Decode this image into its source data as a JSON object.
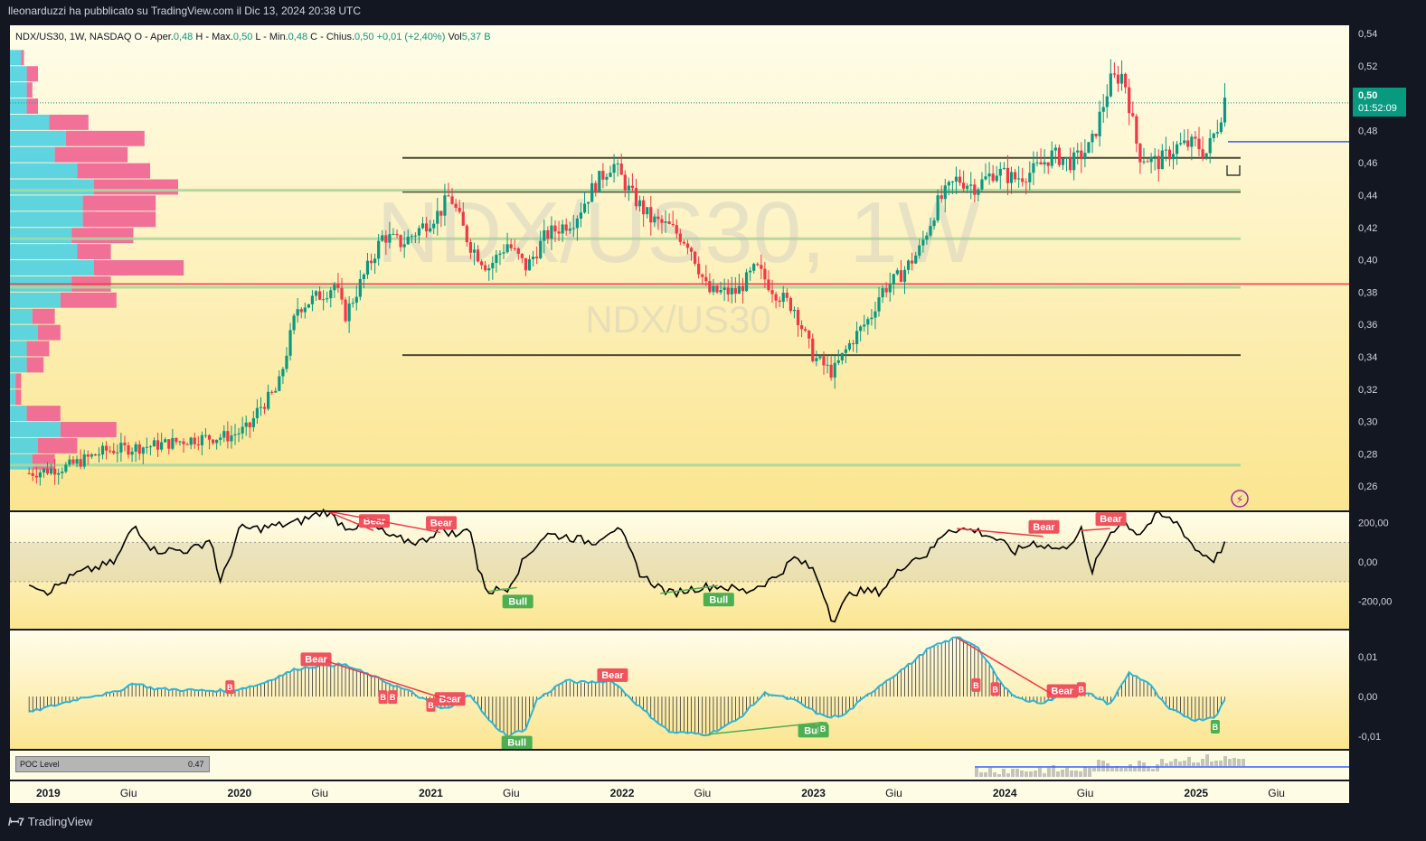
{
  "header": {
    "publisher": "lleonarduzzi ha pubblicato su TradingView.com il Dic 13, 2024 20:38 UTC"
  },
  "legend": {
    "symbol": "NDX/US30, 1W, NASDAQ",
    "open_label": "O - Aper.",
    "open": "0,48",
    "high_label": "H - Max.",
    "high": "0,50",
    "low_label": "L - Min.",
    "low": "0,48",
    "close_label": "C - Chius.",
    "close": "0,50",
    "change": "+0,01 (+2,40%)",
    "vol_label": "Vol",
    "vol": "5,37 B"
  },
  "watermark": {
    "main": "NDX/US30, 1W",
    "sub": "NDX/US30"
  },
  "last_price": {
    "value": "0,50",
    "countdown": "01:52:09"
  },
  "poc": {
    "label": "POC Level",
    "value": "0.47"
  },
  "footer": {
    "brand": "TradingView"
  },
  "colors": {
    "up": "#089981",
    "down": "#f23645",
    "background_top": "#fffce6",
    "background_bottom": "#fbe48a",
    "panel_bg": "#131722",
    "text": "#d1d4dc",
    "level_dark": "#4a4a33",
    "level_green": "#a8d89a",
    "level_red": "#f23645",
    "level_blue": "#2962ff",
    "oscillator": "#000000",
    "macd_line": "#2ab6d8",
    "bull_label": "#4caf50",
    "bear_label": "#f0535b"
  },
  "chart_data": [
    {
      "type": "candlestick",
      "panel": "price",
      "x_axis_labels": [
        "2019",
        "Giu",
        "2020",
        "Giu",
        "2021",
        "Giu",
        "2022",
        "Giu",
        "2023",
        "Giu",
        "2024",
        "Giu",
        "2025",
        "Giu"
      ],
      "y_axis_labels": [
        "0,54",
        "0,52",
        "0,50",
        "0,48",
        "0,46",
        "0,44",
        "0,42",
        "0,40",
        "0,38",
        "0,36",
        "0,34",
        "0,32",
        "0,30",
        "0,28",
        "0,26"
      ],
      "ylim": [
        0.245,
        0.545
      ],
      "xlim_decimal_year": [
        2018.8,
        2025.8
      ],
      "price_path": [
        [
          2018.9,
          0.268
        ],
        [
          2019.1,
          0.272
        ],
        [
          2019.3,
          0.282
        ],
        [
          2019.55,
          0.285
        ],
        [
          2019.75,
          0.289
        ],
        [
          2019.95,
          0.291
        ],
        [
          2020.05,
          0.296
        ],
        [
          2020.1,
          0.308
        ],
        [
          2020.2,
          0.32
        ],
        [
          2020.25,
          0.345
        ],
        [
          2020.3,
          0.37
        ],
        [
          2020.45,
          0.38
        ],
        [
          2020.5,
          0.385
        ],
        [
          2020.55,
          0.365
        ],
        [
          2020.65,
          0.39
        ],
        [
          2020.75,
          0.415
        ],
        [
          2020.85,
          0.41
        ],
        [
          2020.95,
          0.42
        ],
        [
          2021.05,
          0.43
        ],
        [
          2021.1,
          0.44
        ],
        [
          2021.2,
          0.41
        ],
        [
          2021.3,
          0.395
        ],
        [
          2021.4,
          0.41
        ],
        [
          2021.5,
          0.395
        ],
        [
          2021.6,
          0.415
        ],
        [
          2021.75,
          0.425
        ],
        [
          2021.85,
          0.445
        ],
        [
          2021.95,
          0.46
        ],
        [
          2022.05,
          0.44
        ],
        [
          2022.15,
          0.425
        ],
        [
          2022.25,
          0.42
        ],
        [
          2022.35,
          0.41
        ],
        [
          2022.45,
          0.38
        ],
        [
          2022.6,
          0.38
        ],
        [
          2022.7,
          0.395
        ],
        [
          2022.8,
          0.38
        ],
        [
          2022.9,
          0.37
        ],
        [
          2023.0,
          0.34
        ],
        [
          2023.05,
          0.335
        ],
        [
          2023.1,
          0.33
        ],
        [
          2023.2,
          0.35
        ],
        [
          2023.3,
          0.365
        ],
        [
          2023.35,
          0.38
        ],
        [
          2023.45,
          0.39
        ],
        [
          2023.55,
          0.405
        ],
        [
          2023.65,
          0.435
        ],
        [
          2023.75,
          0.45
        ],
        [
          2023.85,
          0.445
        ],
        [
          2023.95,
          0.455
        ],
        [
          2024.05,
          0.45
        ],
        [
          2024.15,
          0.455
        ],
        [
          2024.25,
          0.465
        ],
        [
          2024.35,
          0.46
        ],
        [
          2024.45,
          0.47
        ],
        [
          2024.55,
          0.51
        ],
        [
          2024.62,
          0.515
        ],
        [
          2024.7,
          0.465
        ],
        [
          2024.8,
          0.46
        ],
        [
          2024.9,
          0.47
        ],
        [
          2025.0,
          0.472
        ],
        [
          2025.05,
          0.465
        ],
        [
          2025.12,
          0.485
        ],
        [
          2025.15,
          0.5
        ]
      ],
      "horizontal_levels": [
        {
          "price": 0.463,
          "color": "dark"
        },
        {
          "price": 0.442,
          "color": "dark"
        },
        {
          "price": 0.341,
          "color": "dark"
        },
        {
          "price": 0.413,
          "color": "green"
        },
        {
          "price": 0.383,
          "color": "green"
        },
        {
          "price": 0.273,
          "color": "green"
        },
        {
          "price": 0.443,
          "color": "green"
        },
        {
          "price": 0.385,
          "color": "red"
        },
        {
          "price": 0.473,
          "color": "blue"
        },
        {
          "price": 0.497,
          "color": "dotted"
        }
      ],
      "volume_profile": {
        "price_step": 0.01,
        "rows": [
          {
            "price": 0.52,
            "buy": 2,
            "sell": 0.5
          },
          {
            "price": 0.51,
            "buy": 3,
            "sell": 2
          },
          {
            "price": 0.5,
            "buy": 3,
            "sell": 1
          },
          {
            "price": 0.49,
            "buy": 3,
            "sell": 2
          },
          {
            "price": 0.48,
            "buy": 7,
            "sell": 7
          },
          {
            "price": 0.47,
            "buy": 10,
            "sell": 14
          },
          {
            "price": 0.46,
            "buy": 8,
            "sell": 13
          },
          {
            "price": 0.45,
            "buy": 12,
            "sell": 13
          },
          {
            "price": 0.44,
            "buy": 15,
            "sell": 15
          },
          {
            "price": 0.43,
            "buy": 13,
            "sell": 13
          },
          {
            "price": 0.42,
            "buy": 13,
            "sell": 13
          },
          {
            "price": 0.41,
            "buy": 11,
            "sell": 11
          },
          {
            "price": 0.4,
            "buy": 12,
            "sell": 6
          },
          {
            "price": 0.39,
            "buy": 15,
            "sell": 16
          },
          {
            "price": 0.38,
            "buy": 11,
            "sell": 7
          },
          {
            "price": 0.37,
            "buy": 9,
            "sell": 10
          },
          {
            "price": 0.36,
            "buy": 4,
            "sell": 4
          },
          {
            "price": 0.35,
            "buy": 5,
            "sell": 4
          },
          {
            "price": 0.34,
            "buy": 3,
            "sell": 4
          },
          {
            "price": 0.33,
            "buy": 3,
            "sell": 3
          },
          {
            "price": 0.32,
            "buy": 1,
            "sell": 1
          },
          {
            "price": 0.31,
            "buy": 1,
            "sell": 1
          },
          {
            "price": 0.3,
            "buy": 3,
            "sell": 6
          },
          {
            "price": 0.29,
            "buy": 9,
            "sell": 10
          },
          {
            "price": 0.28,
            "buy": 5,
            "sell": 7
          },
          {
            "price": 0.27,
            "buy": 4,
            "sell": 4
          }
        ]
      }
    },
    {
      "type": "line",
      "panel": "cci",
      "y_axis_labels": [
        "200,00",
        "0,00",
        "-200,00"
      ],
      "ylim": [
        -330,
        230
      ],
      "band": [
        -100,
        100
      ],
      "series": [
        {
          "values": [
            [
              2018.9,
              -100
            ],
            [
              2019.0,
              -150
            ],
            [
              2019.15,
              -60
            ],
            [
              2019.35,
              0
            ],
            [
              2019.45,
              190
            ],
            [
              2019.55,
              60
            ],
            [
              2019.75,
              60
            ],
            [
              2019.85,
              120
            ],
            [
              2019.9,
              -110
            ],
            [
              2020.0,
              170
            ],
            [
              2020.1,
              170
            ],
            [
              2020.3,
              200
            ],
            [
              2020.45,
              260
            ],
            [
              2020.55,
              180
            ],
            [
              2020.7,
              180
            ],
            [
              2020.8,
              120
            ],
            [
              2020.95,
              100
            ],
            [
              2021.05,
              170
            ],
            [
              2021.15,
              130
            ],
            [
              2021.2,
              200
            ],
            [
              2021.25,
              -50
            ],
            [
              2021.3,
              -150
            ],
            [
              2021.4,
              -130
            ],
            [
              2021.5,
              30
            ],
            [
              2021.6,
              140
            ],
            [
              2021.7,
              130
            ],
            [
              2021.85,
              100
            ],
            [
              2021.95,
              170
            ],
            [
              2022.0,
              140
            ],
            [
              2022.1,
              -70
            ],
            [
              2022.25,
              -160
            ],
            [
              2022.4,
              -130
            ],
            [
              2022.5,
              -120
            ],
            [
              2022.65,
              -150
            ],
            [
              2022.8,
              -80
            ],
            [
              2022.9,
              20
            ],
            [
              2023.0,
              -40
            ],
            [
              2023.05,
              -150
            ],
            [
              2023.1,
              -300
            ],
            [
              2023.2,
              -150
            ],
            [
              2023.35,
              -150
            ],
            [
              2023.5,
              10
            ],
            [
              2023.6,
              40
            ],
            [
              2023.7,
              170
            ],
            [
              2023.85,
              160
            ],
            [
              2023.95,
              120
            ],
            [
              2024.05,
              50
            ],
            [
              2024.15,
              100
            ],
            [
              2024.3,
              60
            ],
            [
              2024.4,
              160
            ],
            [
              2024.45,
              -60
            ],
            [
              2024.55,
              150
            ],
            [
              2024.62,
              210
            ],
            [
              2024.7,
              140
            ],
            [
              2024.8,
              240
            ],
            [
              2024.9,
              200
            ],
            [
              2025.0,
              60
            ],
            [
              2025.1,
              10
            ],
            [
              2025.15,
              100
            ]
          ],
          "divergences": [
            {
              "type": "Bear",
              "from": [
                2020.45,
                260
              ],
              "to": [
                2020.7,
                160
              ]
            },
            {
              "type": "Bear",
              "from": [
                2020.45,
                260
              ],
              "to": [
                2021.05,
                150
              ]
            },
            {
              "type": "Bull",
              "from": [
                2021.3,
                -150
              ],
              "to": [
                2021.45,
                -130
              ]
            },
            {
              "type": "Bull",
              "from": [
                2022.2,
                -160
              ],
              "to": [
                2022.5,
                -120
              ]
            },
            {
              "type": "Bear",
              "from": [
                2023.75,
                170
              ],
              "to": [
                2024.2,
                130
              ]
            },
            {
              "type": "Bear",
              "from": [
                2024.4,
                160
              ],
              "to": [
                2024.55,
                170
              ]
            }
          ]
        }
      ],
      "labels": [
        "Bear",
        "Bear",
        "Bull",
        "Bull",
        "Bear",
        "Bear"
      ]
    },
    {
      "type": "line",
      "panel": "macd",
      "y_axis_labels": [
        "0,01",
        "0,00",
        "-0,01"
      ],
      "ylim": [
        -0.0125,
        0.0155
      ],
      "series": [
        {
          "values": [
            [
              2018.9,
              -0.004
            ],
            [
              2019.05,
              -0.002
            ],
            [
              2019.2,
              0
            ],
            [
              2019.35,
              0.001
            ],
            [
              2019.45,
              0.0035
            ],
            [
              2019.55,
              0.002
            ],
            [
              2019.8,
              0.0015
            ],
            [
              2019.95,
              0.0015
            ],
            [
              2020.1,
              0.003
            ],
            [
              2020.3,
              0.007
            ],
            [
              2020.45,
              0.008
            ],
            [
              2020.55,
              0.008
            ],
            [
              2020.7,
              0.005
            ],
            [
              2020.9,
              0.001
            ],
            [
              2021.05,
              -0.003
            ],
            [
              2021.1,
              -0.003
            ],
            [
              2021.2,
              0.001
            ],
            [
              2021.3,
              -0.006
            ],
            [
              2021.4,
              -0.01
            ],
            [
              2021.5,
              -0.008
            ],
            [
              2021.55,
              -0.001
            ],
            [
              2021.7,
              0.004
            ],
            [
              2021.8,
              0.0035
            ],
            [
              2021.95,
              0.004
            ],
            [
              2022.1,
              -0.003
            ],
            [
              2022.25,
              -0.009
            ],
            [
              2022.45,
              -0.0095
            ],
            [
              2022.6,
              -0.006
            ],
            [
              2022.75,
              0.001
            ],
            [
              2022.9,
              -0.001
            ],
            [
              2023.05,
              -0.005
            ],
            [
              2023.15,
              -0.005
            ],
            [
              2023.35,
              0.003
            ],
            [
              2023.5,
              0.008
            ],
            [
              2023.6,
              0.012
            ],
            [
              2023.75,
              0.015
            ],
            [
              2023.85,
              0.013
            ],
            [
              2024.0,
              0.002
            ],
            [
              2024.1,
              -0.001
            ],
            [
              2024.2,
              -0.0015
            ],
            [
              2024.35,
              0.001
            ],
            [
              2024.45,
              0.0005
            ],
            [
              2024.55,
              -0.002
            ],
            [
              2024.65,
              0.006
            ],
            [
              2024.75,
              0.0035
            ],
            [
              2024.85,
              -0.003
            ],
            [
              2025.0,
              -0.006
            ],
            [
              2025.1,
              -0.005
            ],
            [
              2025.15,
              -0.001
            ]
          ]
        }
      ],
      "labels": [
        "Bear",
        "Bear",
        "Bear",
        "Bull",
        "Bull",
        "Bear",
        "B",
        "B",
        "B",
        "B",
        "B",
        "B",
        "B",
        "B",
        "B"
      ]
    }
  ]
}
